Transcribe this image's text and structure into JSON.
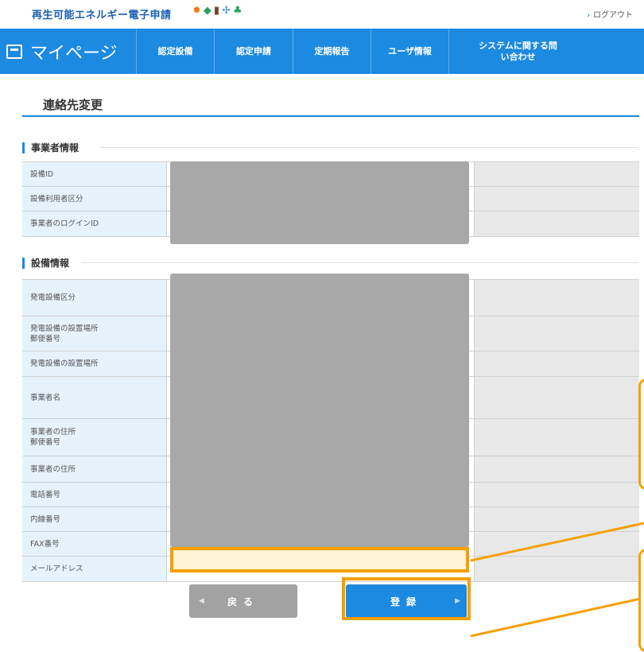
{
  "header": {
    "site_title": "再生可能エネルギー電子申請",
    "logout_label": "ログアウト"
  },
  "nav": {
    "mypage_label": "マイページ",
    "items": [
      {
        "label": "認定設備"
      },
      {
        "label": "認定申請"
      },
      {
        "label": "定期報告"
      },
      {
        "label": "ユーザ情報"
      },
      {
        "label": "システムに関する問い合わせ"
      }
    ]
  },
  "page": {
    "title": "連絡先変更"
  },
  "operator_section": {
    "heading": "事業者情報",
    "rows": [
      {
        "label": "設備ID"
      },
      {
        "label": "設備利用者区分"
      },
      {
        "label": "事業者のログインID"
      }
    ]
  },
  "facility_section": {
    "heading": "設備情報",
    "rows": [
      {
        "label": "発電設備区分"
      },
      {
        "label": "発電設備の設置場所\n郵便番号"
      },
      {
        "label": "発電設備の設置場所"
      },
      {
        "label": "事業者名"
      },
      {
        "label": "事業者の住所\n郵便番号"
      },
      {
        "label": "事業者の住所"
      },
      {
        "label": "電話番号"
      },
      {
        "label": "内線番号"
      },
      {
        "label": "FAX番号"
      },
      {
        "label": "メールアドレス"
      }
    ]
  },
  "buttons": {
    "back_label": "戻る",
    "register_label": "登録"
  },
  "colors": {
    "primary": "#1c8ae0",
    "highlight": "#f5a000",
    "label_bg": "#e6f3fd",
    "redacted": "#a8a8a8"
  }
}
